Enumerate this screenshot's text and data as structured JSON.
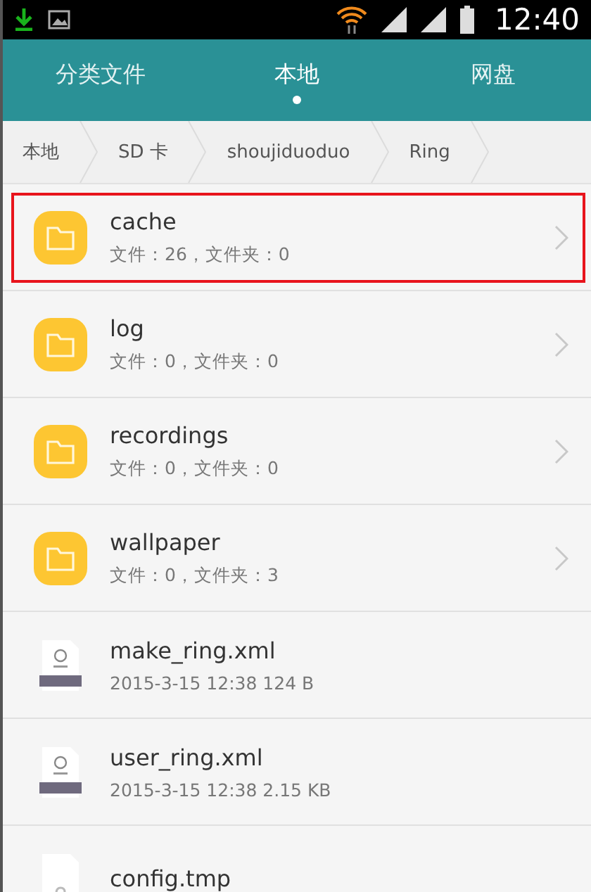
{
  "status_bar": {
    "time": "12:40"
  },
  "tabs": [
    {
      "label": "分类文件",
      "selected": false
    },
    {
      "label": "本地",
      "selected": true
    },
    {
      "label": "网盘",
      "selected": false
    }
  ],
  "breadcrumb": [
    "本地",
    "SD 卡",
    "shoujiduoduo",
    "Ring"
  ],
  "files": [
    {
      "kind": "folder",
      "name": "cache",
      "detail": "文件：26，文件夹：0",
      "highlighted": true
    },
    {
      "kind": "folder",
      "name": "log",
      "detail": "文件：0，文件夹：0",
      "highlighted": false
    },
    {
      "kind": "folder",
      "name": "recordings",
      "detail": "文件：0，文件夹：0",
      "highlighted": false
    },
    {
      "kind": "folder",
      "name": "wallpaper",
      "detail": "文件：0，文件夹：3",
      "highlighted": false
    },
    {
      "kind": "xml",
      "name": "make_ring.xml",
      "detail": "2015-3-15 12:38 124 B",
      "highlighted": false
    },
    {
      "kind": "xml",
      "name": "user_ring.xml",
      "detail": "2015-3-15 12:38 2.15 KB",
      "highlighted": false
    },
    {
      "kind": "unknown",
      "name": "config.tmp",
      "highlighted": false
    }
  ]
}
